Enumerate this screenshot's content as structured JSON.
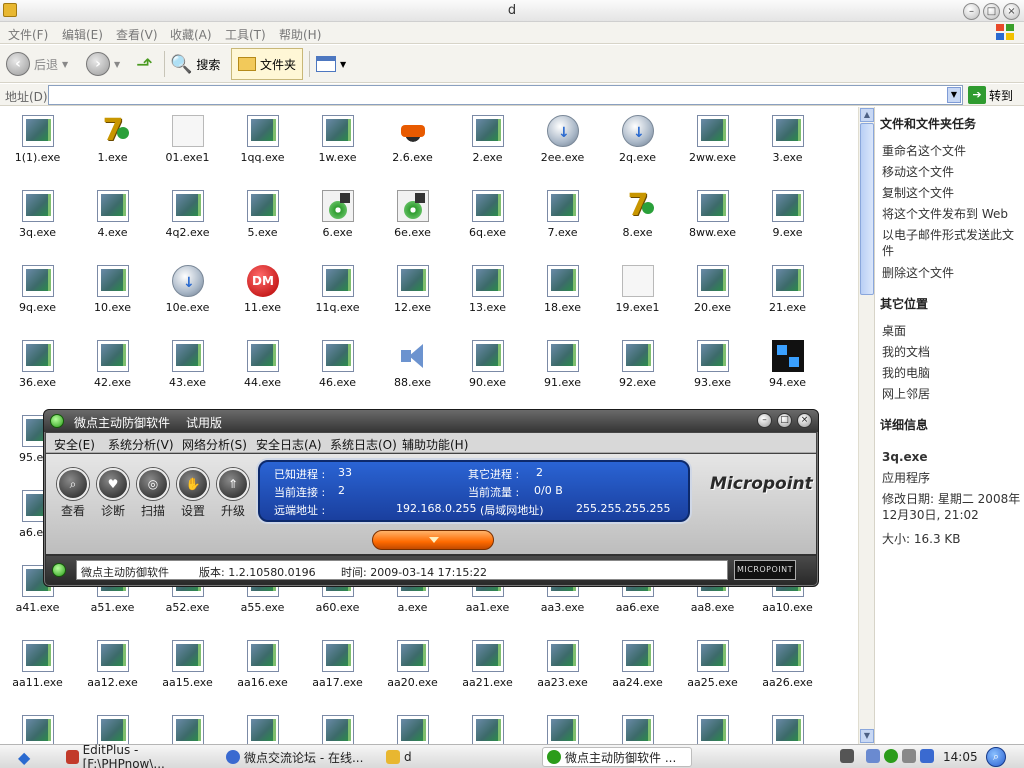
{
  "window": {
    "title": "d"
  },
  "menu": [
    "文件(F)",
    "编辑(E)",
    "查看(V)",
    "收藏(A)",
    "工具(T)",
    "帮助(H)"
  ],
  "toolbar": {
    "back": "后退",
    "search": "搜索",
    "folders": "文件夹"
  },
  "address": {
    "label": "地址(D)",
    "value": "",
    "go": "转到"
  },
  "files": [
    {
      "name": "1(1).exe",
      "icon": "exe"
    },
    {
      "name": "1.exe",
      "icon": "seven"
    },
    {
      "name": "01.exe1",
      "icon": "blank"
    },
    {
      "name": "1qq.exe",
      "icon": "exe"
    },
    {
      "name": "1w.exe",
      "icon": "exe"
    },
    {
      "name": "2.6.exe",
      "icon": "pinball"
    },
    {
      "name": "2.exe",
      "icon": "exe"
    },
    {
      "name": "2ee.exe",
      "icon": "globe"
    },
    {
      "name": "2q.exe",
      "icon": "globe"
    },
    {
      "name": "2ww.exe",
      "icon": "exe"
    },
    {
      "name": "3.exe",
      "icon": "exe"
    },
    {
      "name": "3q.exe",
      "icon": "exe"
    },
    {
      "name": "4.exe",
      "icon": "exe"
    },
    {
      "name": "4q2.exe",
      "icon": "exe"
    },
    {
      "name": "5.exe",
      "icon": "exe"
    },
    {
      "name": "6.exe",
      "icon": "setup"
    },
    {
      "name": "6e.exe",
      "icon": "setup"
    },
    {
      "name": "6q.exe",
      "icon": "exe"
    },
    {
      "name": "7.exe",
      "icon": "exe"
    },
    {
      "name": "8.exe",
      "icon": "seven"
    },
    {
      "name": "8ww.exe",
      "icon": "exe"
    },
    {
      "name": "9.exe",
      "icon": "exe"
    },
    {
      "name": "9q.exe",
      "icon": "exe"
    },
    {
      "name": "10.exe",
      "icon": "exe"
    },
    {
      "name": "10e.exe",
      "icon": "globe"
    },
    {
      "name": "11.exe",
      "icon": "dm"
    },
    {
      "name": "11q.exe",
      "icon": "exe"
    },
    {
      "name": "12.exe",
      "icon": "exe"
    },
    {
      "name": "13.exe",
      "icon": "exe"
    },
    {
      "name": "18.exe",
      "icon": "exe"
    },
    {
      "name": "19.exe1",
      "icon": "blank"
    },
    {
      "name": "20.exe",
      "icon": "exe"
    },
    {
      "name": "21.exe",
      "icon": "exe"
    },
    {
      "name": "36.exe",
      "icon": "exe"
    },
    {
      "name": "42.exe",
      "icon": "exe"
    },
    {
      "name": "43.exe",
      "icon": "exe"
    },
    {
      "name": "44.exe",
      "icon": "exe"
    },
    {
      "name": "46.exe",
      "icon": "exe"
    },
    {
      "name": "88.exe",
      "icon": "speaker"
    },
    {
      "name": "90.exe",
      "icon": "exe"
    },
    {
      "name": "91.exe",
      "icon": "exe"
    },
    {
      "name": "92.exe",
      "icon": "exe"
    },
    {
      "name": "93.exe",
      "icon": "exe"
    },
    {
      "name": "94.exe",
      "icon": "cube"
    },
    {
      "name": "95.exe",
      "icon": "exe"
    },
    null,
    null,
    null,
    null,
    null,
    null,
    null,
    null,
    null,
    null,
    {
      "name": "a6.exe",
      "icon": "exe"
    },
    null,
    null,
    null,
    null,
    null,
    null,
    null,
    null,
    null,
    null,
    {
      "name": "a41.exe",
      "icon": "exe"
    },
    {
      "name": "a51.exe",
      "icon": "exe"
    },
    {
      "name": "a52.exe",
      "icon": "exe"
    },
    {
      "name": "a55.exe",
      "icon": "exe"
    },
    {
      "name": "a60.exe",
      "icon": "exe"
    },
    {
      "name": "a.exe",
      "icon": "exe"
    },
    {
      "name": "aa1.exe",
      "icon": "exe"
    },
    {
      "name": "aa3.exe",
      "icon": "exe"
    },
    {
      "name": "aa6.exe",
      "icon": "exe"
    },
    {
      "name": "aa8.exe",
      "icon": "exe"
    },
    {
      "name": "aa10.exe",
      "icon": "exe"
    },
    {
      "name": "aa11.exe",
      "icon": "exe"
    },
    {
      "name": "aa12.exe",
      "icon": "exe"
    },
    {
      "name": "aa15.exe",
      "icon": "exe"
    },
    {
      "name": "aa16.exe",
      "icon": "exe"
    },
    {
      "name": "aa17.exe",
      "icon": "exe"
    },
    {
      "name": "aa20.exe",
      "icon": "exe"
    },
    {
      "name": "aa21.exe",
      "icon": "exe"
    },
    {
      "name": "aa23.exe",
      "icon": "exe"
    },
    {
      "name": "aa24.exe",
      "icon": "exe"
    },
    {
      "name": "aa25.exe",
      "icon": "exe"
    },
    {
      "name": "aa26.exe",
      "icon": "exe"
    },
    {
      "name": "",
      "icon": "exe"
    },
    {
      "name": "",
      "icon": "exe"
    },
    {
      "name": "",
      "icon": "exe"
    },
    {
      "name": "",
      "icon": "exe"
    },
    {
      "name": "",
      "icon": "exe"
    },
    {
      "name": "",
      "icon": "exe"
    },
    {
      "name": "",
      "icon": "exe"
    },
    {
      "name": "",
      "icon": "exe"
    },
    {
      "name": "",
      "icon": "exe"
    },
    {
      "name": "",
      "icon": "exe"
    },
    {
      "name": "",
      "icon": "exe"
    }
  ],
  "taskpane": {
    "file_tasks": {
      "title": "文件和文件夹任务",
      "items": [
        "重命名这个文件",
        "移动这个文件",
        "复制这个文件",
        "将这个文件发布到 Web",
        "以电子邮件形式发送此文件",
        "删除这个文件"
      ]
    },
    "other_places": {
      "title": "其它位置",
      "items": [
        "桌面",
        "我的文档",
        "我的电脑",
        "网上邻居"
      ]
    },
    "details": {
      "title": "详细信息",
      "name": "3q.exe",
      "type": "应用程序",
      "modified": "修改日期: 星期二 2008年12月30日, 21:02",
      "size": "大小: 16.3 KB"
    }
  },
  "micropoint": {
    "title": "微点主动防御软件",
    "subtitle": "试用版",
    "menu": [
      "安全(E)",
      "系统分析(V)",
      "网络分析(S)",
      "安全日志(A)",
      "系统日志(O)",
      "辅助功能(H)"
    ],
    "tools": [
      "查看",
      "诊断",
      "扫描",
      "设置",
      "升级"
    ],
    "stats": {
      "processes_label": "已知进程 :",
      "processes": "33",
      "other_label": "其它进程 :",
      "other": "2",
      "conn_label": "当前连接 :",
      "conn": "2",
      "traffic_label": "当前流量 :",
      "traffic": "0/0 B",
      "remote_label": "远端地址 :",
      "remote_ip": "192.168.0.255",
      "remote_note": "(局域网地址)",
      "mask": "255.255.255.255"
    },
    "logo": "Micropoint",
    "status": {
      "app": "微点主动防御软件",
      "version": "版本: 1.2.10580.0196",
      "time": "时间: 2009-03-14 17:15:22",
      "badge": "MICROPOINT"
    }
  },
  "taskbar": {
    "tasks": [
      "EditPlus - [F:\\PHPnow\\...",
      "微点交流论坛 - 在线...",
      "d",
      "微点主动防御软件 ..."
    ],
    "clock": "14:05"
  }
}
